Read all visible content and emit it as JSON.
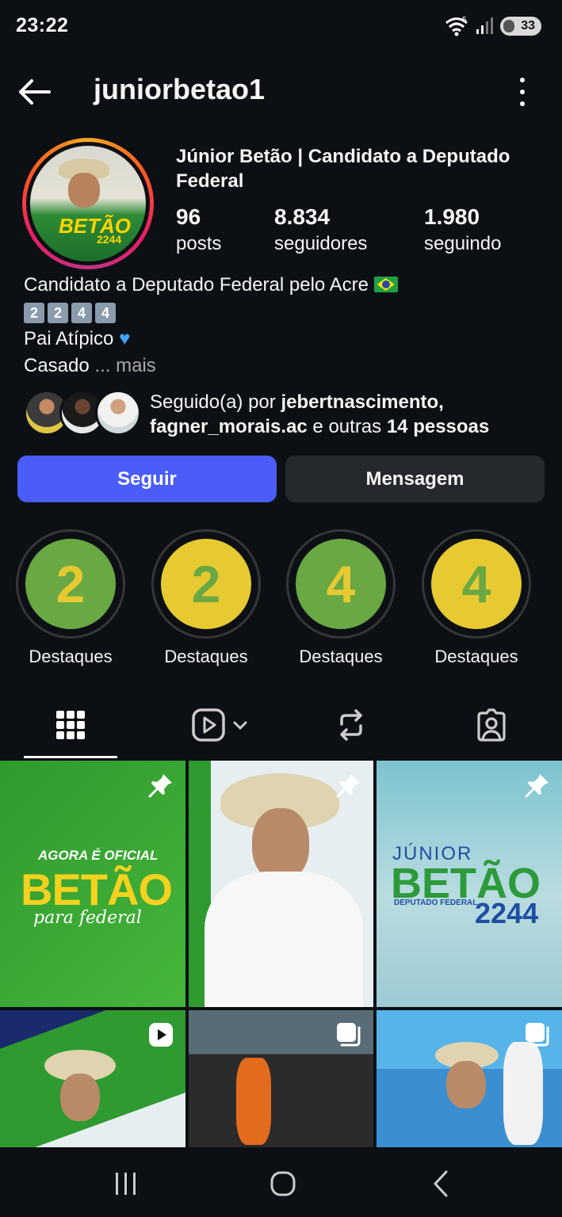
{
  "status_bar": {
    "time": "23:22",
    "wifi_label": "5",
    "battery": "33"
  },
  "top_bar": {
    "username": "juniorbetao1"
  },
  "profile": {
    "full_name": "Júnior Betão | Candidato a Deputado Federal",
    "avatar_brand": "BETÃO",
    "avatar_number": "2244",
    "stats": [
      {
        "value": "96",
        "label": "posts"
      },
      {
        "value": "8.834",
        "label": "seguidores"
      },
      {
        "value": "1.980",
        "label": "seguindo"
      }
    ],
    "bio": {
      "line1": "Candidato a Deputado Federal pelo Acre",
      "keycaps": [
        "2",
        "2",
        "4",
        "4"
      ],
      "line3": "Pai Atípico",
      "line4": "Casado",
      "more": "... mais"
    },
    "followed_by": {
      "prefix": "Seguido(a) por ",
      "names": "jebertnascimento, fagner_morais.ac",
      "connector": " e outras ",
      "others": "14 pessoas"
    }
  },
  "buttons": {
    "follow": "Seguir",
    "message": "Mensagem"
  },
  "highlights": [
    {
      "digit": "2",
      "label": "Destaques",
      "style": "g"
    },
    {
      "digit": "2",
      "label": "Destaques",
      "style": "y"
    },
    {
      "digit": "4",
      "label": "Destaques",
      "style": "g"
    },
    {
      "digit": "4",
      "label": "Destaques",
      "style": "y"
    }
  ],
  "posts": [
    {
      "headline": "AGORA É OFICIAL",
      "brand": "BETÃO",
      "sub": "para federal",
      "badge": "pin"
    },
    {
      "badge": "pin"
    },
    {
      "top": "JÚNIOR",
      "brand": "BETÃO",
      "sub": "DEPUTADO FEDERAL",
      "number": "2244",
      "badge": "pin"
    },
    {
      "badge": "reel"
    },
    {
      "badge": "carousel"
    },
    {
      "badge": "carousel"
    }
  ],
  "colors": {
    "follow_button": "#4a5df9",
    "green": "#69a843",
    "yellow": "#e7c931",
    "background": "#0c1014"
  }
}
